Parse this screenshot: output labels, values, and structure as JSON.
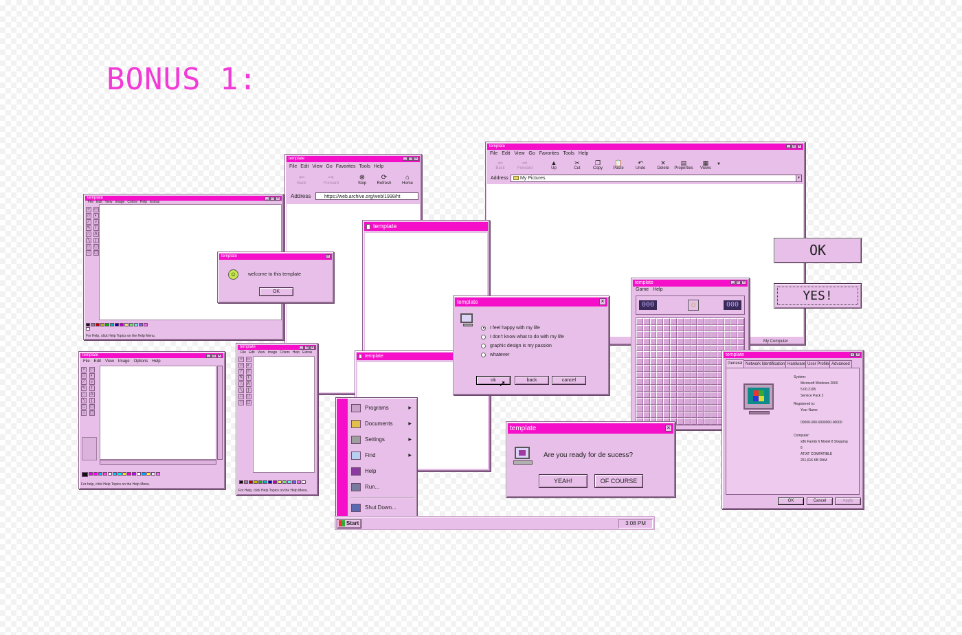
{
  "heading": "BONUS 1:",
  "win_title": "template",
  "paint": {
    "menu": [
      "File",
      "Edit",
      "View",
      "Image",
      "Colors",
      "Help",
      "Extras"
    ],
    "menu_b": [
      "File",
      "Edit",
      "View",
      "Image",
      "Options",
      "Help"
    ],
    "status": "For Help, click Help Topics on the Help Menu.",
    "status_b": "For help, click Help Topics on the Help Menu."
  },
  "welcome": {
    "message": "welcome to this template",
    "ok": "OK"
  },
  "browser": {
    "menu": [
      "File",
      "Edit",
      "View",
      "Go",
      "Favorites",
      "Tools",
      "Help"
    ],
    "toolbar": [
      "Back",
      "Forward",
      "Stop",
      "Refresh",
      "Home"
    ],
    "address_label": "Address",
    "address": "https://web.archive.org/web/1998/ht"
  },
  "explorer": {
    "menu": [
      "File",
      "Edit",
      "View",
      "Go",
      "Favorites",
      "Tools",
      "Help"
    ],
    "toolbar": [
      "Back",
      "Forward",
      "Up",
      "Cut",
      "Copy",
      "Paste",
      "Undo",
      "Delete",
      "Properties",
      "Views"
    ],
    "address_label": "Address",
    "address": "My Pictures",
    "status": "My Computer"
  },
  "big_buttons": {
    "ok": "OK",
    "yes": "YES!"
  },
  "survey": {
    "options": [
      "I feel happy with my life",
      "I don't know what to do with my life",
      "graphic design is my passion",
      "whatever"
    ],
    "buttons": [
      "ok",
      "back",
      "cancel"
    ]
  },
  "mines": {
    "menu": [
      "Game",
      "Help"
    ],
    "count_left": "000",
    "count_right": "000"
  },
  "start_menu": {
    "items": [
      "Programs",
      "Documents",
      "Settings",
      "Find",
      "Help",
      "Run...",
      "Shut Down..."
    ],
    "start_label": "Start",
    "clock": "3:08 PM"
  },
  "ready": {
    "question": "Are you ready for de sucess?",
    "yes": "YEAH!",
    "ofcourse": "OF COURSE"
  },
  "sysprops": {
    "tabs": [
      "General",
      "Network Identification",
      "Hardware",
      "User Profiles",
      "Advanced"
    ],
    "system_label": "System:",
    "system_lines": [
      "Microsoft Windows 2000",
      "5.00.2195",
      "Service Pack 2"
    ],
    "registered_label": "Registered to:",
    "registered_lines": [
      "Your Name",
      "",
      "00000-000-0000000-00000"
    ],
    "computer_label": "Computer:",
    "computer_lines": [
      "x86 Family 6 Model 8 Stepping",
      "6",
      "AT/AT COMPATIBLE",
      "261,616 KB RAM"
    ],
    "buttons": [
      "OK",
      "Cancel",
      "Apply"
    ]
  },
  "colors": {
    "accent": "#f50fc8",
    "window": "#e8bfe8",
    "heading": "#f23ad6"
  }
}
